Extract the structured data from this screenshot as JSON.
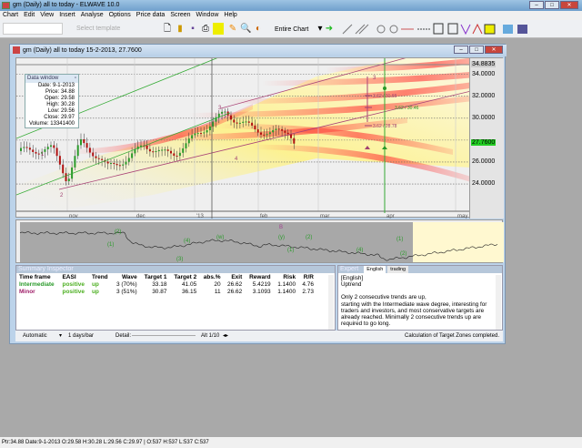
{
  "app": {
    "title": "gm (Daily)  all to today - ELWAVE 10.0"
  },
  "menu": [
    "Chart",
    "Edit",
    "View",
    "Insert",
    "Analyse",
    "Options",
    "Price data",
    "Screen",
    "Window",
    "Help"
  ],
  "toolbar": {
    "template_placeholder": "Select template",
    "zoom_mode": "Entire Chart"
  },
  "chart_window": {
    "title": "gm (Daily)  all to today  15-2-2013, 27.7600",
    "data_window": {
      "title": "Data window",
      "rows": [
        "Date: 9-1-2013",
        "Price: 34.88",
        "Open: 29.58",
        "High: 30.28",
        "Low: 29.56",
        "Close: 29.97",
        "Volume: 13341400"
      ]
    },
    "price_labels": [
      "34.8835",
      "34.0000",
      "32.0000",
      "30.0000",
      "27.7600",
      "26.0000",
      "24.0000"
    ],
    "current_price": "27.7600",
    "month_labels": [
      "nov",
      "dec",
      "'13",
      "feb",
      "mar",
      "apr",
      "may"
    ],
    "wave_labels": [
      "1",
      "2",
      "3",
      "4",
      "3"
    ],
    "target_labels": [
      "3.62 / 31.66",
      "3.62 / 30.46",
      "3.62 / 28.78"
    ],
    "osc_labels": [
      "(1)",
      "(2)",
      "(3)",
      "(4)",
      "(w)",
      "(y)",
      "(1)",
      "(2)",
      "(4)",
      "(1)",
      "(2)",
      "B"
    ]
  },
  "summary": {
    "title": "Summary Inspector",
    "headers": [
      "Time frame",
      "EASI",
      "Trend",
      "Wave",
      "Target 1",
      "Target 2",
      "abs.%",
      "Exit",
      "Reward",
      "Risk",
      "R/R"
    ],
    "rows": [
      [
        "Intermediate",
        "positive",
        "up",
        "3 (70%)",
        "33.18",
        "41.05",
        "20",
        "26.62",
        "5.4219",
        "1.1400",
        "4.76"
      ],
      [
        "Minor",
        "positive",
        "up",
        "3 (51%)",
        "30.87",
        "36.15",
        "11",
        "26.62",
        "3.1093",
        "1.1400",
        "2.73"
      ]
    ]
  },
  "expert": {
    "title": "Expert",
    "tabs": [
      "English",
      "trading"
    ],
    "lines": [
      "[English]",
      "Uptrend",
      "",
      "Only 2 consecutive trends are up,",
      "starting with the Intermediate wave degree, interesting for",
      "traders and investors, and most conservative targets are",
      "already reached. Minimally 2 consecutive trends up are",
      "required to go long."
    ],
    "status": "Calculation of Target Zones completed."
  },
  "bottombar": {
    "mode": "Automatic",
    "period": "1 days/bar",
    "detail_label": "Detail:",
    "alt": "Alt 1/10"
  },
  "statusbar": "Ptr:34.88  Date:9-1-2013  O:29.58  H:30.28  L:29.56  C:29.97 | O:537  H:537  L:537  C:537",
  "colors": {
    "intermediate": "#2a9a2a",
    "minor": "#a0206a",
    "positive": "#4caf20",
    "current": "#22cc22"
  }
}
